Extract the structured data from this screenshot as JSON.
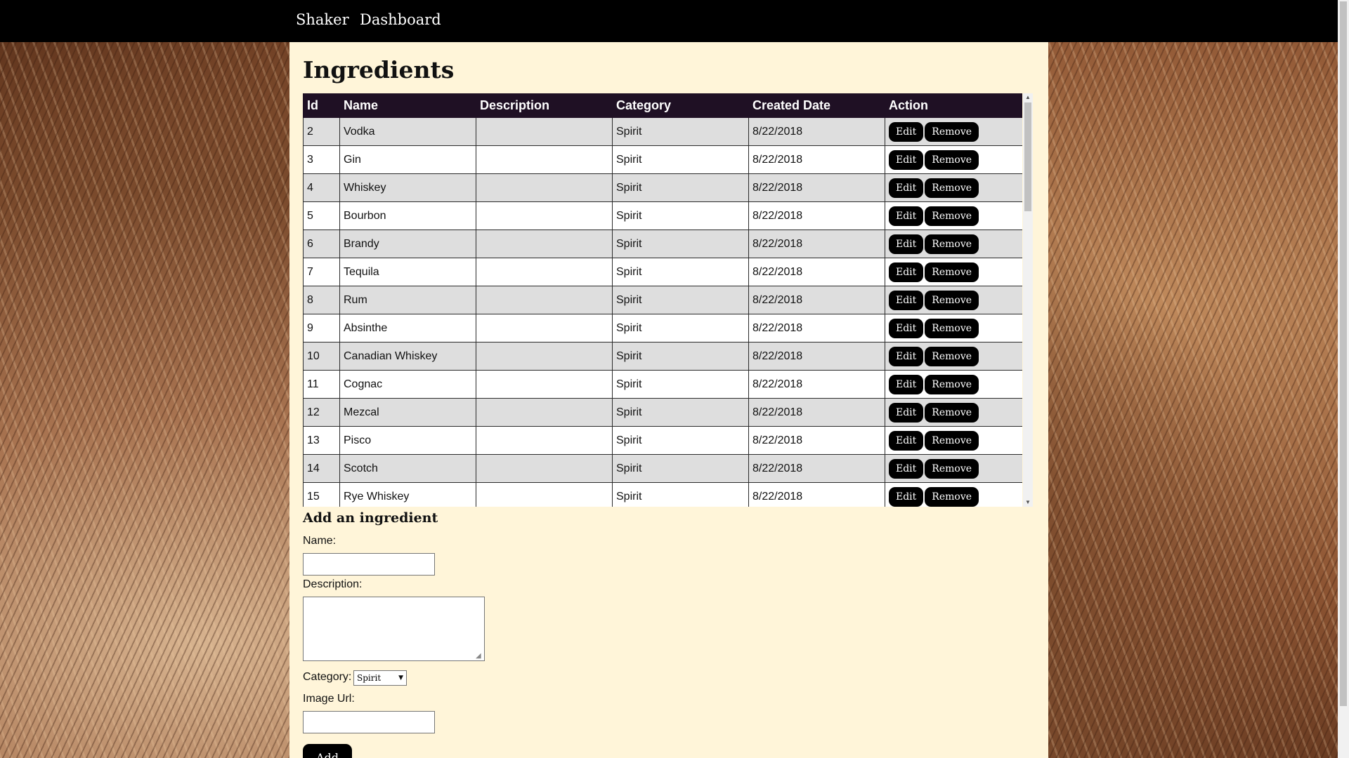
{
  "nav": {
    "brand": "Shaker",
    "dashboard": "Dashboard"
  },
  "page": {
    "title": "Ingredients"
  },
  "table": {
    "columns": [
      "Id",
      "Name",
      "Description",
      "Category",
      "Created Date",
      "Action"
    ],
    "rows": [
      {
        "id": "2",
        "name": "Vodka",
        "description": "",
        "category": "Spirit",
        "created": "8/22/2018"
      },
      {
        "id": "3",
        "name": "Gin",
        "description": "",
        "category": "Spirit",
        "created": "8/22/2018"
      },
      {
        "id": "4",
        "name": "Whiskey",
        "description": "",
        "category": "Spirit",
        "created": "8/22/2018"
      },
      {
        "id": "5",
        "name": "Bourbon",
        "description": "",
        "category": "Spirit",
        "created": "8/22/2018"
      },
      {
        "id": "6",
        "name": "Brandy",
        "description": "",
        "category": "Spirit",
        "created": "8/22/2018"
      },
      {
        "id": "7",
        "name": "Tequila",
        "description": "",
        "category": "Spirit",
        "created": "8/22/2018"
      },
      {
        "id": "8",
        "name": "Rum",
        "description": "",
        "category": "Spirit",
        "created": "8/22/2018"
      },
      {
        "id": "9",
        "name": "Absinthe",
        "description": "",
        "category": "Spirit",
        "created": "8/22/2018"
      },
      {
        "id": "10",
        "name": "Canadian Whiskey",
        "description": "",
        "category": "Spirit",
        "created": "8/22/2018"
      },
      {
        "id": "11",
        "name": "Cognac",
        "description": "",
        "category": "Spirit",
        "created": "8/22/2018"
      },
      {
        "id": "12",
        "name": "Mezcal",
        "description": "",
        "category": "Spirit",
        "created": "8/22/2018"
      },
      {
        "id": "13",
        "name": "Pisco",
        "description": "",
        "category": "Spirit",
        "created": "8/22/2018"
      },
      {
        "id": "14",
        "name": "Scotch",
        "description": "",
        "category": "Spirit",
        "created": "8/22/2018"
      },
      {
        "id": "15",
        "name": "Rye Whiskey",
        "description": "",
        "category": "Spirit",
        "created": "8/22/2018"
      }
    ],
    "edit_label": "Edit",
    "remove_label": "Remove"
  },
  "form": {
    "heading": "Add an ingredient",
    "name_label": "Name:",
    "name_value": "",
    "description_label": "Description:",
    "description_value": "",
    "category_label": "Category:",
    "category_selected": "Spirit",
    "image_label": "Image Url:",
    "image_value": "",
    "add_label": "Add"
  },
  "colors": {
    "nav_bg": "#000000",
    "content_bg": "#fff5d9",
    "table_header_bg": "#1f1024",
    "row_odd_bg": "#dedede",
    "row_even_bg": "#ffffff",
    "button_bg": "#000000"
  }
}
